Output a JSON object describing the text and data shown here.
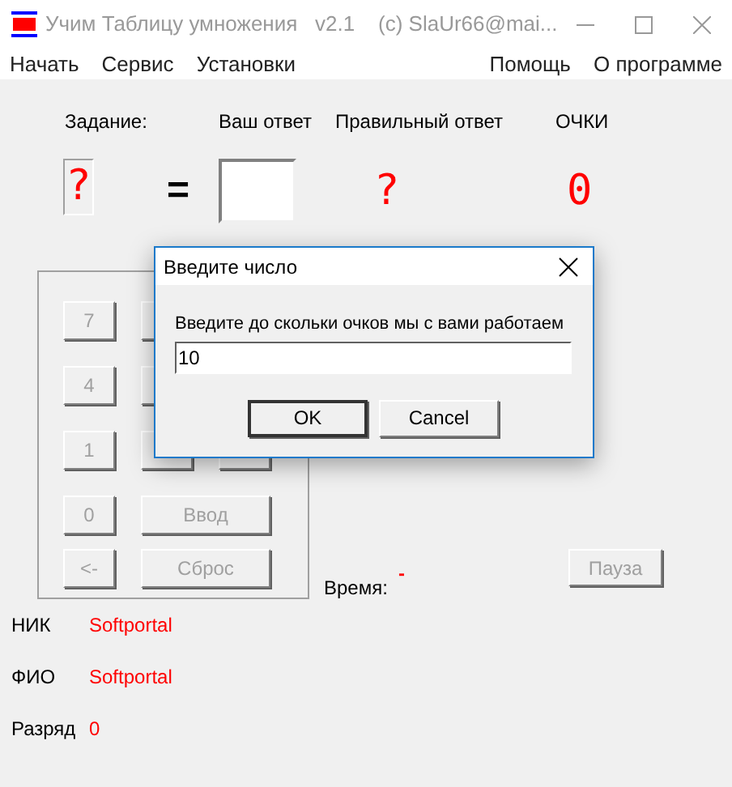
{
  "window": {
    "title": "Учим Таблицу умножения   v2.1    (c) SlaUr66@mai..."
  },
  "menu": {
    "left": [
      "Начать",
      "Сервис",
      "Установки"
    ],
    "right": [
      "Помощь",
      "О программе"
    ]
  },
  "headers": [
    "Задание:",
    "Ваш ответ",
    "Правильный ответ",
    "ОЧКИ"
  ],
  "task": {
    "text": "?",
    "equals": "=",
    "correct": "?",
    "score": "0"
  },
  "keypad": [
    {
      "label": "7",
      "disabled": true
    },
    {
      "label": "4",
      "disabled": true
    },
    {
      "label": "1",
      "disabled": true
    },
    {
      "label": "0",
      "disabled": true
    },
    {
      "label": "Ввод",
      "disabled": true
    },
    {
      "label": "<-",
      "disabled": true
    },
    {
      "label": "Сброс",
      "disabled": true
    }
  ],
  "timer": {
    "label": "Время:",
    "value": "-"
  },
  "pause_button": {
    "label": "Пауза",
    "disabled": true
  },
  "info": [
    {
      "label": "НИК",
      "value": "Softportal"
    },
    {
      "label": "ФИО",
      "value": "Softportal"
    },
    {
      "label": "Разряд",
      "value": "0"
    }
  ],
  "dialog": {
    "title": "Введите число",
    "prompt": "Введите до скольки очков мы с вами работаем",
    "value": "10",
    "buttons": [
      {
        "label": "OK",
        "default": true
      },
      {
        "label": "Cancel",
        "default": false
      }
    ]
  }
}
